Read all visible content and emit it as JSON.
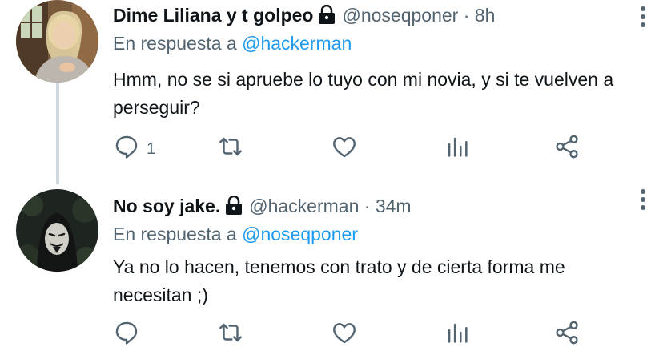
{
  "tweets": [
    {
      "display_name": "Dime Liliana y t golpeo",
      "handle": "@noseqponer",
      "separator": "·",
      "time": "8h",
      "reply_prefix": "En respuesta a",
      "reply_to": "@hackerman",
      "text": "Hmm, no se si apruebe lo tuyo con mi novia, y si te vuelven a perseguir?",
      "reply_count": "1",
      "retweet_count": "",
      "like_count": "",
      "locked": true
    },
    {
      "display_name": "No soy jake.",
      "handle": "@hackerman",
      "separator": "·",
      "time": "34m",
      "reply_prefix": "En respuesta a",
      "reply_to": "@noseqponer",
      "text": "Ya no lo hacen, tenemos con trato y de cierta forma me necesitan ;)",
      "reply_count": "",
      "retweet_count": "",
      "like_count": "",
      "locked": true
    }
  ],
  "icons": [
    "lock-icon",
    "more-icon",
    "reply-icon",
    "retweet-icon",
    "like-icon",
    "analytics-icon",
    "share-icon"
  ],
  "colors": {
    "text": "#0f1419",
    "secondary": "#536471",
    "link": "#1d9bf0",
    "thread_line": "#cfd9de"
  }
}
